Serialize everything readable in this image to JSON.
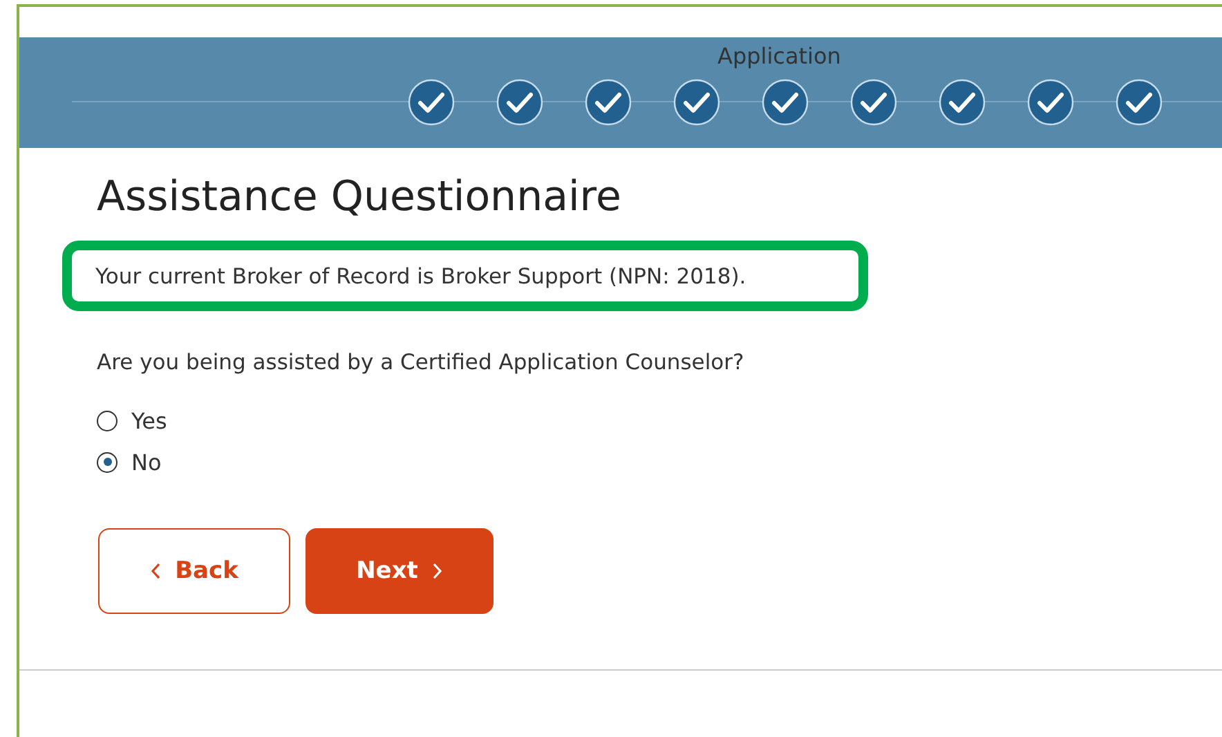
{
  "progress": {
    "label": "Application",
    "steps": [
      {
        "completed": true
      },
      {
        "completed": true
      },
      {
        "completed": true
      },
      {
        "completed": true
      },
      {
        "completed": true
      },
      {
        "completed": true
      },
      {
        "completed": true
      },
      {
        "completed": true
      },
      {
        "completed": true
      }
    ]
  },
  "title": "Assistance Questionnaire",
  "notice": {
    "text": "Your current Broker of Record is Broker Support (NPN: 2018).",
    "highlighted": true
  },
  "question": "Are you being assisted by a Certified Application Counselor?",
  "options": [
    {
      "label": "Yes",
      "selected": false
    },
    {
      "label": "No",
      "selected": true
    }
  ],
  "buttons": [
    {
      "kind": "back",
      "label": "Back"
    },
    {
      "kind": "next",
      "label": "Next"
    }
  ]
}
